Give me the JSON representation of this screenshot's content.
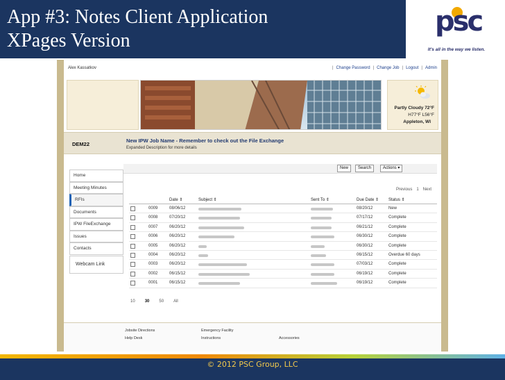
{
  "slide": {
    "title_line1": "App #3: Notes Client Application",
    "title_line2": "XPages Version",
    "logo_text": "psc",
    "logo_tagline": "It's all in the way we listen.",
    "copyright": "© 2012 PSC Group, LLC"
  },
  "app": {
    "user": "Alex Kassatkov",
    "top_links": [
      "Change Password",
      "Change Job",
      "Logout",
      "Admin"
    ],
    "weather": {
      "condition_temp": "Partly Cloudy  72°F",
      "hi_lo": "H77°F L56°F",
      "location": "Appleton, WI",
      "icon": "partly-cloudy-icon"
    },
    "job": {
      "code": "DEM22",
      "title": "New IPW Job Name - Remember to check out the File Exchange",
      "description": "Expanded Description for more details"
    },
    "nav": [
      "Home",
      "Meeting Minutes",
      "RFIs",
      "Documents",
      "IPW FileExchange",
      "Issues",
      "Contacts"
    ],
    "nav_active": "RFIs",
    "webcam": "Webcam Link",
    "toolbar": {
      "new": "New",
      "search": "Search",
      "actions": "Actions ▾"
    },
    "pager": {
      "previous": "Previous",
      "page": "1",
      "next": "Next"
    },
    "columns": {
      "date": "Date ⇕",
      "subject": "Subject ⇕",
      "sent_to": "Sent To ⇕",
      "due_date": "Due Date ⇕",
      "status": "Status ⇕"
    },
    "rows": [
      {
        "num": "0009",
        "date": "08/06/12",
        "due": "08/20/12",
        "status": "New"
      },
      {
        "num": "0008",
        "date": "07/20/12",
        "due": "07/17/12",
        "status": "Complete"
      },
      {
        "num": "0007",
        "date": "06/20/12",
        "due": "06/21/12",
        "status": "Complete"
      },
      {
        "num": "0006",
        "date": "06/20/12",
        "due": "06/30/12",
        "status": "Complete"
      },
      {
        "num": "0005",
        "date": "06/20/12",
        "due": "06/30/12",
        "status": "Complete"
      },
      {
        "num": "0004",
        "date": "06/20/12",
        "due": "06/15/12",
        "status": "Overdue 60 days"
      },
      {
        "num": "0003",
        "date": "06/20/12",
        "due": "07/03/12",
        "status": "Complete"
      },
      {
        "num": "0002",
        "date": "06/15/12",
        "due": "06/19/12",
        "status": "Complete"
      },
      {
        "num": "0001",
        "date": "06/15/12",
        "due": "06/19/12",
        "status": "Complete"
      }
    ],
    "page_sizes": [
      "10",
      "30",
      "50",
      "All"
    ],
    "page_size_current": "30",
    "bottom_links": {
      "jobsite_directions": "Jobsite Directions",
      "help_desk": "Help Desk",
      "emergency_facility": "Emergency Facility",
      "instructions": "Instructions",
      "accessories": "Accessories"
    }
  }
}
